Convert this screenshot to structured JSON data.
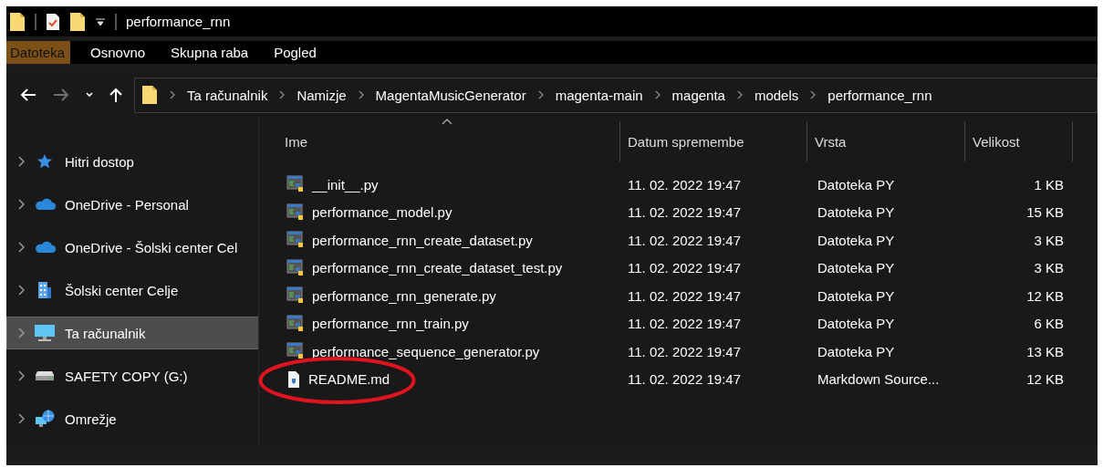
{
  "window": {
    "title": "performance_rnn"
  },
  "ribbon_tabs": [
    {
      "label": "Datoteka",
      "selected": true
    },
    {
      "label": "Osnovno",
      "selected": false
    },
    {
      "label": "Skupna raba",
      "selected": false
    },
    {
      "label": "Pogled",
      "selected": false
    }
  ],
  "nav_buttons": [
    {
      "kind": "back",
      "disabled": false
    },
    {
      "kind": "forward",
      "disabled": true
    },
    {
      "kind": "recent",
      "disabled": false
    },
    {
      "kind": "up",
      "disabled": false
    }
  ],
  "breadcrumbs": [
    "Ta računalnik",
    "Namizje",
    "MagentaMusicGenerator",
    "magenta-main",
    "magenta",
    "models",
    "performance_rnn"
  ],
  "sidebar": {
    "items": [
      {
        "kind": "quick",
        "label": "Hitri dostop",
        "selected": false
      },
      {
        "kind": "cloud",
        "label": "OneDrive - Personal",
        "selected": false
      },
      {
        "kind": "cloud",
        "label": "OneDrive - Šolski center Cel",
        "selected": false
      },
      {
        "kind": "building",
        "label": "Šolski center Celje",
        "selected": false
      },
      {
        "kind": "computer",
        "label": "Ta računalnik",
        "selected": true
      },
      {
        "kind": "drive",
        "label": "SAFETY COPY (G:)",
        "selected": false
      },
      {
        "kind": "network",
        "label": "Omrežje",
        "selected": false
      }
    ]
  },
  "table": {
    "columns": [
      {
        "label": "Ime",
        "sorted": true
      },
      {
        "label": "Datum spremembe",
        "sorted": false
      },
      {
        "label": "Vrsta",
        "sorted": false
      },
      {
        "label": "Velikost",
        "sorted": false
      }
    ],
    "rows": [
      {
        "kind": "python",
        "name": "__init__.py",
        "date": "11. 02. 2022 19:47",
        "type": "Datoteka PY",
        "size": "1 KB",
        "circled": false
      },
      {
        "kind": "python",
        "name": "performance_model.py",
        "date": "11. 02. 2022 19:47",
        "type": "Datoteka PY",
        "size": "15 KB",
        "circled": false
      },
      {
        "kind": "python",
        "name": "performance_rnn_create_dataset.py",
        "date": "11. 02. 2022 19:47",
        "type": "Datoteka PY",
        "size": "3 KB",
        "circled": false
      },
      {
        "kind": "python",
        "name": "performance_rnn_create_dataset_test.py",
        "date": "11. 02. 2022 19:47",
        "type": "Datoteka PY",
        "size": "3 KB",
        "circled": false
      },
      {
        "kind": "python",
        "name": "performance_rnn_generate.py",
        "date": "11. 02. 2022 19:47",
        "type": "Datoteka PY",
        "size": "12 KB",
        "circled": false
      },
      {
        "kind": "python",
        "name": "performance_rnn_train.py",
        "date": "11. 02. 2022 19:47",
        "type": "Datoteka PY",
        "size": "6 KB",
        "circled": false
      },
      {
        "kind": "python",
        "name": "performance_sequence_generator.py",
        "date": "11. 02. 2022 19:47",
        "type": "Datoteka PY",
        "size": "13 KB",
        "circled": false
      },
      {
        "kind": "markdown",
        "name": "README.md",
        "date": "11. 02. 2022 19:47",
        "type": "Markdown Source...",
        "size": "12 KB",
        "circled": true
      }
    ]
  }
}
